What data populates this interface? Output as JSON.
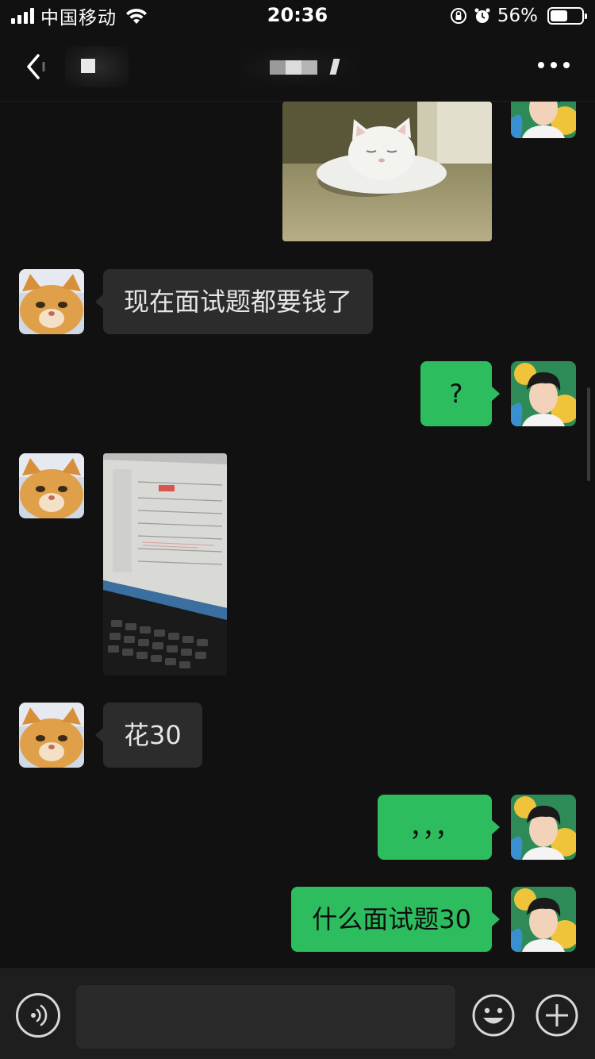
{
  "status_bar": {
    "carrier": "中国移动",
    "time": "20:36",
    "battery_percent": "56%",
    "battery_level": 0.56,
    "icons": [
      "signal-icon",
      "wifi-icon",
      "rotation-lock-icon",
      "alarm-icon",
      "battery-icon"
    ]
  },
  "nav": {
    "back_icon": "chevron-left-icon",
    "more_icon": "more-dots-icon"
  },
  "messages": [
    {
      "side": "right",
      "type": "image",
      "content": "white cat sleeping photo"
    },
    {
      "side": "left",
      "type": "text",
      "text": "现在面试题都要钱了"
    },
    {
      "side": "right",
      "type": "text",
      "text": "?"
    },
    {
      "side": "left",
      "type": "image",
      "content": "laptop screen photo"
    },
    {
      "side": "left",
      "type": "text",
      "text": "花30"
    },
    {
      "side": "right",
      "type": "text",
      "text": "，，，"
    },
    {
      "side": "right",
      "type": "text",
      "text": "什么面试题30"
    }
  ],
  "input_bar": {
    "voice_icon": "voice-icon",
    "emoji_icon": "emoji-icon",
    "plus_icon": "plus-icon"
  },
  "colors": {
    "background": "#111111",
    "incoming_bubble": "#2c2c2c",
    "outgoing_bubble": "#2dbd5f"
  }
}
